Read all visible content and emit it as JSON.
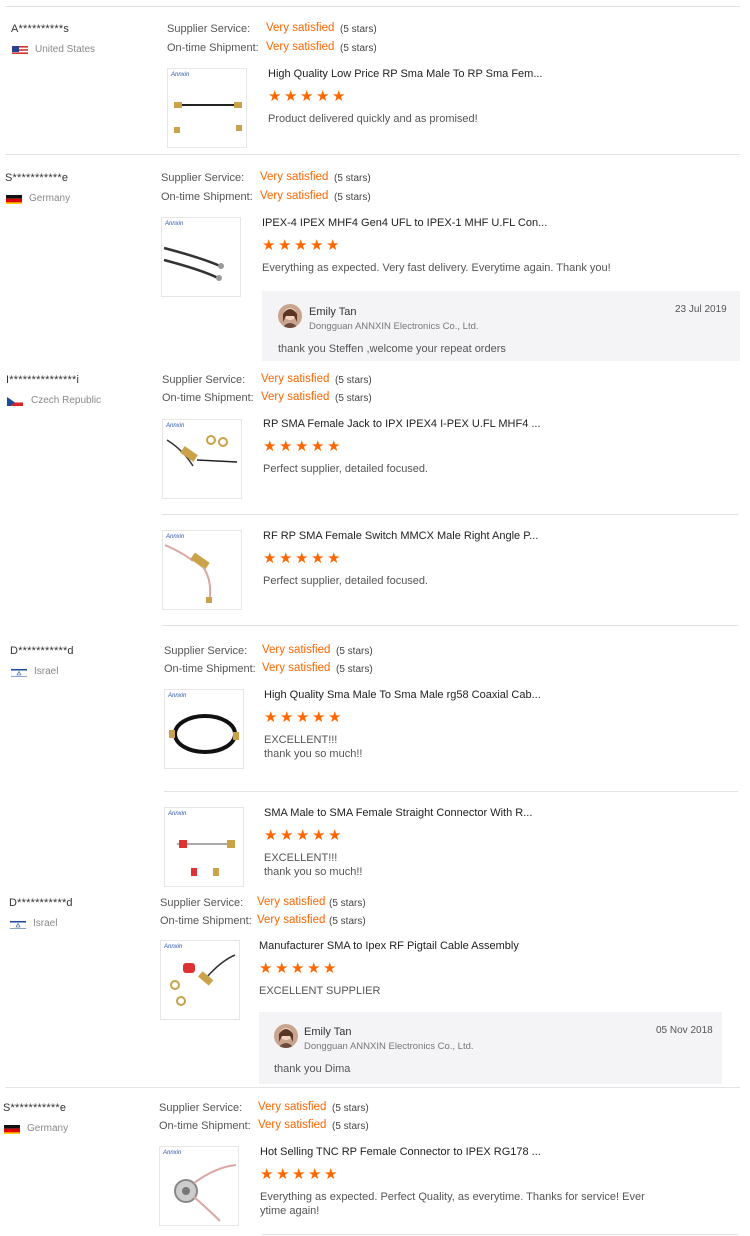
{
  "labels": {
    "supplier_service": "Supplier Service:",
    "ontime_shipment": "On-time Shipment:",
    "very_satisfied": "Very satisfied",
    "five_stars": "(5 stars)"
  },
  "reviews": [
    {
      "name": "A**********s",
      "country": "United States",
      "products": [
        {
          "title": "High Quality Low Price RP Sma Male To RP Sma Fem...",
          "rating": 5,
          "comment": "Product delivered quickly and as promised!"
        }
      ]
    },
    {
      "name": "S***********e",
      "country": "Germany",
      "products": [
        {
          "title": "IPEX-4 IPEX MHF4 Gen4 UFL to IPEX-1 MHF U.FL Con...",
          "rating": 5,
          "comment": "Everything as expected. Very fast delivery. Everytime again. Thank you!"
        }
      ],
      "reply": {
        "name": "Emily Tan",
        "company": "Dongguan ANNXIN Electronics Co., Ltd.",
        "date": "23 Jul 2019",
        "text": "thank you Steffen ,welcome your repeat orders"
      }
    },
    {
      "name": "I***************i",
      "country": "Czech Republic",
      "products": [
        {
          "title": "RP SMA Female Jack to IPX IPEX4 I-PEX U.FL MHF4 ...",
          "rating": 5,
          "comment": "Perfect supplier, detailed focused."
        },
        {
          "title": "RF RP SMA Female Switch MMCX Male Right Angle P...",
          "rating": 5,
          "comment": "Perfect supplier, detailed focused."
        }
      ]
    },
    {
      "name": "D***********d",
      "country": "Israel",
      "products": [
        {
          "title": "High Quality Sma Male To Sma Male rg58 Coaxial Cab...",
          "rating": 5,
          "comment": "EXCELLENT!!!",
          "comment2": "thank you so much!!"
        },
        {
          "title": "SMA Male to SMA Female Straight Connector With R...",
          "rating": 5,
          "comment": "EXCELLENT!!!",
          "comment2": "thank you so much!!"
        }
      ]
    },
    {
      "name": "D***********d",
      "country": "Israel",
      "products": [
        {
          "title": "Manufacturer SMA to Ipex RF Pigtail Cable Assembly",
          "rating": 5,
          "comment": "EXCELLENT SUPPLIER"
        }
      ],
      "reply": {
        "name": "Emily Tan",
        "company": "Dongguan ANNXIN Electronics Co., Ltd.",
        "date": "05 Nov 2018",
        "text": "thank you Dima"
      }
    },
    {
      "name": "S***********e",
      "country": "Germany",
      "products": [
        {
          "title": "Hot Selling TNC RP Female Connector to IPEX RG178 ...",
          "rating": 5,
          "comment": "Everything as expected. Perfect Quality, as everytime. Thanks for service! Ever",
          "comment2": "ytime again!"
        }
      ]
    }
  ],
  "thumb_logo": "Annxin",
  "colors": {
    "accent": "#ff6600"
  }
}
